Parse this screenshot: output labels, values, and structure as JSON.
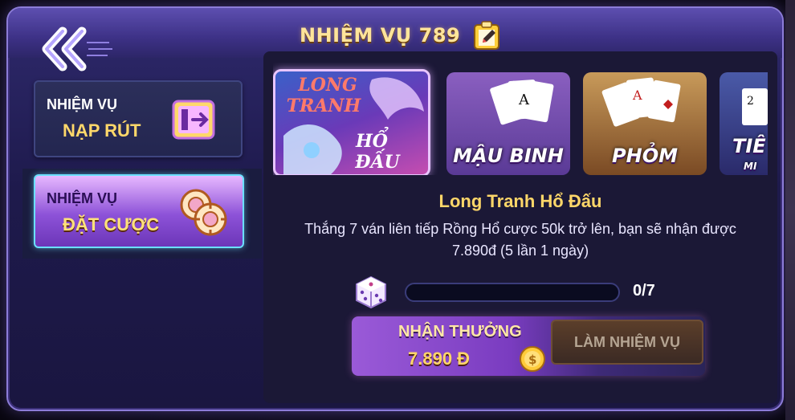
{
  "header": {
    "title": "NHIỆM VỤ 789",
    "back_icon": "double-chevron-left-icon",
    "edit_icon": "clipboard-pencil-icon"
  },
  "sidebar": {
    "items": [
      {
        "line1": "NHIỆM VỤ",
        "line2": "NẠP RÚT",
        "icon": "atm-card-icon",
        "active": false
      },
      {
        "line1": "NHIỆM VỤ",
        "line2": "ĐẶT CƯỢC",
        "icon": "casino-chips-icon",
        "active": true
      }
    ]
  },
  "games": [
    {
      "label_line1": "LONG",
      "label_line2": "TRANH",
      "label_line3": "HỔ",
      "label_line4": "ĐẤU",
      "selected": true
    },
    {
      "label": "MẬU BINH",
      "selected": false
    },
    {
      "label": "PHỎM",
      "selected": false
    },
    {
      "label": "TIÊ",
      "sub": "MI",
      "selected": false
    }
  ],
  "task": {
    "name": "Long Tranh Hổ Đấu",
    "description": "Thắng 7 ván liên tiếp Rồng Hổ cược 50k trở lên, bạn sẽ nhận được 7.890đ (5 lần 1 ngày)",
    "progress_text": "0/7",
    "progress_fraction": 0,
    "dice_icon": "dice-icon"
  },
  "reward": {
    "label": "NHẬN THƯỞNG",
    "amount": "7.890 Đ",
    "coin_icon": "gold-coin-icon",
    "action_label": "LÀM NHIỆM VỤ"
  },
  "colors": {
    "title": "#ffe49a",
    "accent_gold": "#ffd769",
    "active_border": "#6be0ff",
    "panel": "#1e1a4c"
  }
}
